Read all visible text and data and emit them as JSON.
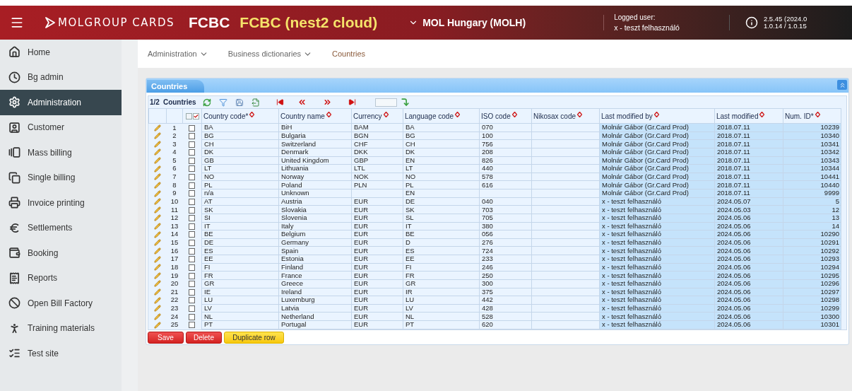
{
  "header": {
    "logo": "MOLGROUP CARDS",
    "app": "FCBC",
    "environment": "FCBC (nest2 cloud)",
    "company": "MOL Hungary (MOLH)",
    "logged_label": "Logged user:",
    "user": "x - teszt felhasználó",
    "version_lines": [
      "2.5.45 (2024.0",
      "1.0.14 / 1.0.15"
    ]
  },
  "sidebar": {
    "items": [
      {
        "label": "Home",
        "selected": false
      },
      {
        "label": "Bg admin",
        "selected": false
      },
      {
        "label": "Administration",
        "selected": true
      },
      {
        "label": "Customer",
        "selected": false
      },
      {
        "label": "Mass billing",
        "selected": false
      },
      {
        "label": "Single billing",
        "selected": false
      },
      {
        "label": "Invoice printing",
        "selected": false
      },
      {
        "label": "Settlements",
        "selected": false
      },
      {
        "label": "Booking",
        "selected": false
      },
      {
        "label": "Reports",
        "selected": false
      },
      {
        "label": "Open Bill Factory",
        "selected": false
      },
      {
        "label": "Training materials",
        "selected": false
      },
      {
        "label": "Test site",
        "selected": false
      }
    ]
  },
  "breadcrumb": [
    {
      "label": "Administration",
      "kind": "menu"
    },
    {
      "label": "Business dictionaries",
      "kind": "menu"
    },
    {
      "label": "Countries",
      "kind": "current"
    }
  ],
  "panel": {
    "title": "Countries",
    "page": "1/2",
    "caption": "Countries",
    "columns": [
      {
        "label": "Country code*",
        "highlighted": false
      },
      {
        "label": "Country name",
        "highlighted": false
      },
      {
        "label": "Currency",
        "highlighted": false
      },
      {
        "label": "Language code",
        "highlighted": false
      },
      {
        "label": "ISO code",
        "highlighted": false
      },
      {
        "label": "Nikosax code",
        "highlighted": false
      },
      {
        "label": "Last modified by",
        "highlighted": true
      },
      {
        "label": "Last modified",
        "highlighted": true
      },
      {
        "label": "Num. ID*",
        "highlighted": true
      }
    ],
    "rows": [
      {
        "number": "1",
        "checked": false,
        "cells": [
          "BA",
          "BiH",
          "BAM",
          "BA",
          "070",
          null,
          "Molnár Gábor (Gr.Card Prod)",
          "2018.07.11",
          "10239"
        ]
      },
      {
        "number": "2",
        "checked": false,
        "cells": [
          "BG",
          "Bulgaria",
          "BGN",
          "BG",
          "100",
          null,
          "Molnár Gábor (Gr.Card Prod)",
          "2018.07.11",
          "10340"
        ]
      },
      {
        "number": "3",
        "checked": false,
        "cells": [
          "CH",
          "Switzerland",
          "CHF",
          "CH",
          "756",
          null,
          "Molnár Gábor (Gr.Card Prod)",
          "2018.07.11",
          "10341"
        ]
      },
      {
        "number": "4",
        "checked": false,
        "cells": [
          "DK",
          "Denmark",
          "DKK",
          "DK",
          "208",
          null,
          "Molnár Gábor (Gr.Card Prod)",
          "2018.07.11",
          "10342"
        ]
      },
      {
        "number": "5",
        "checked": false,
        "cells": [
          "GB",
          "United Kingdom",
          "GBP",
          "EN",
          "826",
          null,
          "Molnár Gábor (Gr.Card Prod)",
          "2018.07.11",
          "10343"
        ]
      },
      {
        "number": "6",
        "checked": false,
        "cells": [
          "LT",
          "Lithuania",
          "LTL",
          "LT",
          "440",
          null,
          "Molnár Gábor (Gr.Card Prod)",
          "2018.07.11",
          "10344"
        ]
      },
      {
        "number": "7",
        "checked": false,
        "cells": [
          "NO",
          "Norway",
          "NOK",
          "NO",
          "578",
          null,
          "Molnár Gábor (Gr.Card Prod)",
          "2018.07.11",
          "10441"
        ]
      },
      {
        "number": "8",
        "checked": false,
        "cells": [
          "PL",
          "Poland",
          "PLN",
          "PL",
          "616",
          null,
          "Molnár Gábor (Gr.Card Prod)",
          "2018.07.11",
          "10440"
        ]
      },
      {
        "number": "9",
        "checked": false,
        "cells": [
          "n/a",
          "Unknown",
          null,
          "EN",
          null,
          null,
          "Molnár Gábor (Gr.Card Prod)",
          "2018.07.11",
          "9999"
        ]
      },
      {
        "number": "10",
        "checked": false,
        "cells": [
          "AT",
          "Austria",
          "EUR",
          "DE",
          "040",
          null,
          "x - teszt felhasználó",
          "2024.05.07",
          "5"
        ]
      },
      {
        "number": "11",
        "checked": false,
        "cells": [
          "SK",
          "Slovakia",
          "EUR",
          "SK",
          "703",
          null,
          "x - teszt felhasználó",
          "2024.05.03",
          "12"
        ]
      },
      {
        "number": "12",
        "checked": false,
        "cells": [
          "SI",
          "Slovenia",
          "EUR",
          "SL",
          "705",
          null,
          "x - teszt felhasználó",
          "2024.05.06",
          "13"
        ]
      },
      {
        "number": "13",
        "checked": false,
        "cells": [
          "IT",
          "Italy",
          "EUR",
          "IT",
          "380",
          null,
          "x - teszt felhasználó",
          "2024.05.06",
          "14"
        ]
      },
      {
        "number": "14",
        "checked": false,
        "cells": [
          "BE",
          "Belgium",
          "EUR",
          "BE",
          "056",
          null,
          "x - teszt felhasználó",
          "2024.05.06",
          "10290"
        ]
      },
      {
        "number": "15",
        "checked": false,
        "cells": [
          "DE",
          "Germany",
          "EUR",
          "D",
          "276",
          null,
          "x - teszt felhasználó",
          "2024.05.06",
          "10291"
        ]
      },
      {
        "number": "16",
        "checked": false,
        "cells": [
          "ES",
          "Spain",
          "EUR",
          "ES",
          "724",
          null,
          "x - teszt felhasználó",
          "2024.05.06",
          "10292"
        ]
      },
      {
        "number": "17",
        "checked": false,
        "cells": [
          "EE",
          "Estonia",
          "EUR",
          "EE",
          "233",
          null,
          "x - teszt felhasználó",
          "2024.05.06",
          "10293"
        ]
      },
      {
        "number": "18",
        "checked": false,
        "cells": [
          "FI",
          "Finland",
          "EUR",
          "FI",
          "246",
          null,
          "x - teszt felhasználó",
          "2024.05.06",
          "10294"
        ]
      },
      {
        "number": "19",
        "checked": false,
        "cells": [
          "FR",
          "France",
          "EUR",
          "FR",
          "250",
          null,
          "x - teszt felhasználó",
          "2024.05.06",
          "10295"
        ]
      },
      {
        "number": "20",
        "checked": false,
        "cells": [
          "GR",
          "Greece",
          "EUR",
          "GR",
          "300",
          null,
          "x - teszt felhasználó",
          "2024.05.06",
          "10296"
        ]
      },
      {
        "number": "21",
        "checked": false,
        "cells": [
          "IE",
          "Ireland",
          "EUR",
          "IR",
          "375",
          null,
          "x - teszt felhasználó",
          "2024.05.06",
          "10297"
        ]
      },
      {
        "number": "22",
        "checked": false,
        "cells": [
          "LU",
          "Luxemburg",
          "EUR",
          "LU",
          "442",
          null,
          "x - teszt felhasználó",
          "2024.05.06",
          "10298"
        ]
      },
      {
        "number": "23",
        "checked": false,
        "cells": [
          "LV",
          "Latvia",
          "EUR",
          "LV",
          "428",
          null,
          "x - teszt felhasználó",
          "2024.05.06",
          "10299"
        ]
      },
      {
        "number": "24",
        "checked": false,
        "cells": [
          "NL",
          "Netherland",
          "EUR",
          "NL",
          "528",
          null,
          "x - teszt felhasználó",
          "2024.05.06",
          "10300"
        ]
      },
      {
        "number": "25",
        "checked": false,
        "cells": [
          "PT",
          "Portugal",
          "EUR",
          "PT",
          "620",
          null,
          "x - teszt felhasználó",
          "2024.05.06",
          "10301"
        ]
      }
    ],
    "buttons": [
      {
        "label": "Save",
        "kind": "danger"
      },
      {
        "label": "Delete",
        "kind": "danger"
      },
      {
        "label": "Duplicate row",
        "kind": "warning"
      }
    ]
  }
}
